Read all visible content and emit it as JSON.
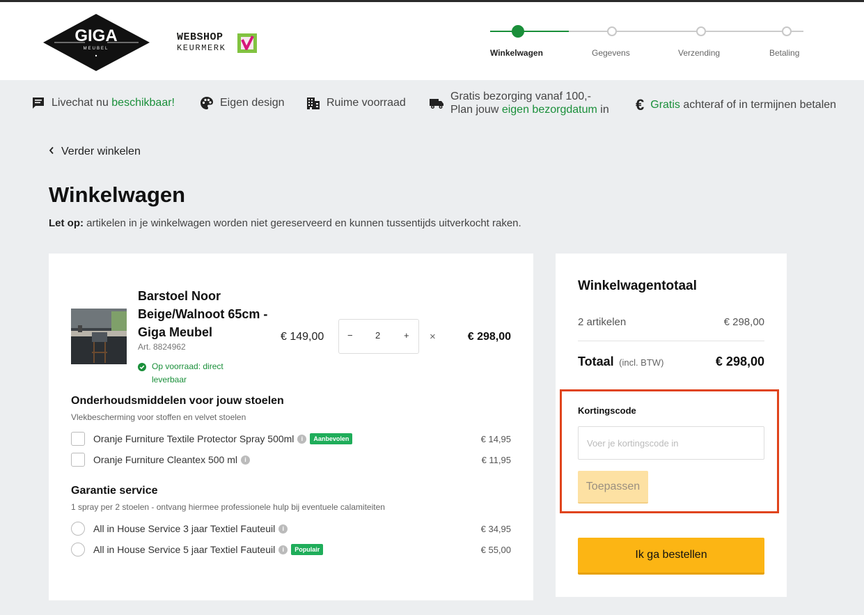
{
  "header": {
    "logo_text": "GIGA",
    "logo_subtext": "MEUBEL",
    "keurmerk_line1": "WEBSHOP",
    "keurmerk_line2": "KEURMERK",
    "steps": [
      {
        "label": "Winkelwagen",
        "active": true
      },
      {
        "label": "Gegevens",
        "active": false
      },
      {
        "label": "Verzending",
        "active": false
      },
      {
        "label": "Betaling",
        "active": false
      }
    ],
    "accent_color": "#1a8f3a"
  },
  "usp": {
    "livechat_a": "Livechat nu ",
    "livechat_b": "beschikbaar!",
    "design": "Eigen design",
    "voorraad": "Ruime voorraad",
    "delivery_line1": "Gratis bezorging vanaf 100,-",
    "delivery_line2_a": "Plan jouw ",
    "delivery_line2_b": "eigen bezorgdatum",
    "delivery_line2_c": " in",
    "pay_a": "Gratis",
    "pay_b": " achteraf of in termijnen betalen"
  },
  "page": {
    "back_label": "Verder winkelen",
    "title": "Winkelwagen",
    "notice_bold": "Let op:",
    "notice_text": " artikelen in je winkelwagen worden niet gereserveerd en kunnen tussentijds uitverkocht raken."
  },
  "cart": {
    "product": {
      "name": "Barstoel Noor Beige/Walnoot 65cm - Giga Meubel",
      "article": "Art. 8824962",
      "stock": "Op voorraad: direct leverbaar",
      "unit_price": "€ 149,00",
      "quantity": "2",
      "minus": "−",
      "plus": "+",
      "times": "×",
      "line_total": "€ 298,00"
    },
    "care": {
      "title": "Onderhoudsmiddelen voor jouw stoelen",
      "subtitle": "Vlekbescherming voor stoffen en velvet stoelen",
      "options": [
        {
          "label": "Oranje Furniture Textile Protector Spray 500ml",
          "tag": "Aanbevolen",
          "price": "€ 14,95"
        },
        {
          "label": "Oranje Furniture Cleantex 500 ml",
          "tag": "",
          "price": "€ 11,95"
        }
      ]
    },
    "warranty": {
      "title": "Garantie service",
      "subtitle": "1 spray per 2 stoelen - ontvang hiermee professionele hulp bij eventuele calamiteiten",
      "options": [
        {
          "label": "All in House Service 3 jaar Textiel Fauteuil",
          "tag": "",
          "price": "€ 34,95"
        },
        {
          "label": "All in House Service 5 jaar Textiel Fauteuil",
          "tag": "Populair",
          "price": "€ 55,00"
        }
      ]
    },
    "info_glyph": "i"
  },
  "summary": {
    "title": "Winkelwagentotaal",
    "items_label": "2 artikelen",
    "items_value": "€ 298,00",
    "total_label": "Totaal",
    "total_note": "(incl. BTW)",
    "total_value": "€ 298,00",
    "coupon_label": "Kortingscode",
    "coupon_placeholder": "Voer je kortingscode in",
    "coupon_value": "",
    "apply_label": "Toepassen",
    "order_label": "Ik ga bestellen",
    "highlight_color": "#e0441c",
    "order_color": "#fcb514"
  }
}
